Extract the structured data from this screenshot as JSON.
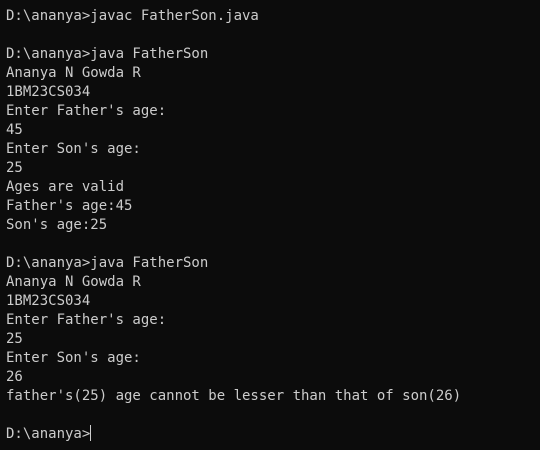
{
  "terminal": {
    "lines": [
      "D:\\ananya>javac FatherSon.java",
      "",
      "D:\\ananya>java FatherSon",
      "Ananya N Gowda R",
      "1BM23CS034",
      "Enter Father's age:",
      "45",
      "Enter Son's age:",
      "25",
      "Ages are valid",
      "Father's age:45",
      "Son's age:25",
      "",
      "D:\\ananya>java FatherSon",
      "Ananya N Gowda R",
      "1BM23CS034",
      "Enter Father's age:",
      "25",
      "Enter Son's age:",
      "26",
      "father's(25) age cannot be lesser than that of son(26)",
      "",
      "D:\\ananya>"
    ]
  }
}
